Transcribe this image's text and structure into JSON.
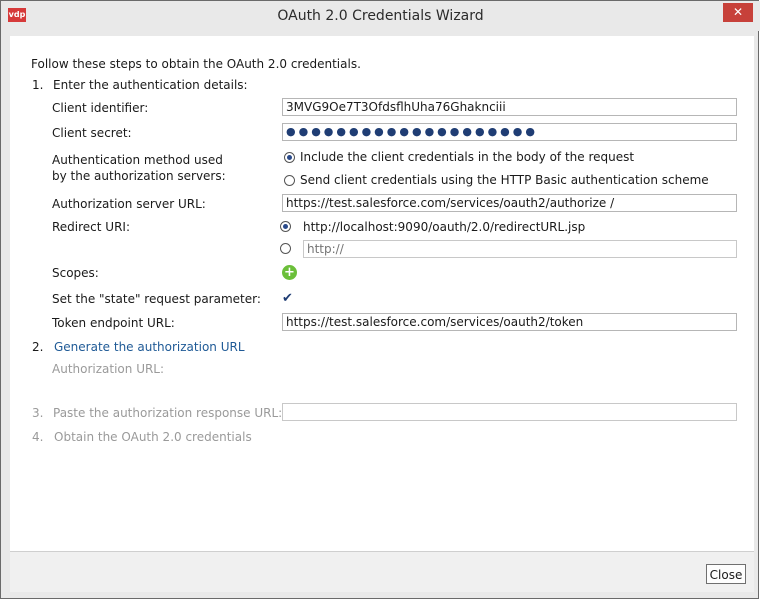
{
  "window": {
    "title": "OAuth 2.0 Credentials Wizard",
    "app_icon": "vdp",
    "close_glyph": "✕"
  },
  "intro": "Follow these steps to obtain the OAuth 2.0 credentials.",
  "steps": [
    {
      "number": "1.",
      "label": "Enter the authentication details:"
    },
    {
      "number": "2.",
      "label": "Generate the authorization URL"
    },
    {
      "number": "3.",
      "label": "Paste the authorization response URL:"
    },
    {
      "number": "4.",
      "label": "Obtain the OAuth 2.0 credentials"
    }
  ],
  "fields": {
    "client_identifier": {
      "label": "Client identifier:",
      "value": "3MVG9Oe7T3OfdsflhUha76Ghaknciii"
    },
    "client_secret": {
      "label": "Client secret:",
      "masked_value": "●●●●●●●●●●●●●●●●●●●●"
    },
    "auth_method": {
      "label_line1": "Authentication method used",
      "label_line2": "by the authorization servers:",
      "options": [
        {
          "label": "Include the client credentials in the body of the request",
          "selected": true
        },
        {
          "label": "Send client credentials using the HTTP Basic authentication scheme",
          "selected": false
        }
      ]
    },
    "authorization_server_url": {
      "label": "Authorization server URL:",
      "value": "https://test.salesforce.com/services/oauth2/authorize /"
    },
    "redirect_uri": {
      "label": "Redirect URI:",
      "default_option": "http://localhost:9090/oauth/2.0/redirectURL.jsp",
      "custom_placeholder": "http://"
    },
    "scopes": {
      "label": "Scopes:",
      "add_glyph": "+"
    },
    "state_param": {
      "label": "Set the \"state\" request parameter:",
      "checked": true,
      "glyph": "✔"
    },
    "token_endpoint_url": {
      "label": "Token endpoint URL:",
      "value": "https://test.salesforce.com/services/oauth2/token"
    },
    "authorization_url": {
      "label": "Authorization URL:"
    }
  },
  "buttons": {
    "close": "Close"
  }
}
